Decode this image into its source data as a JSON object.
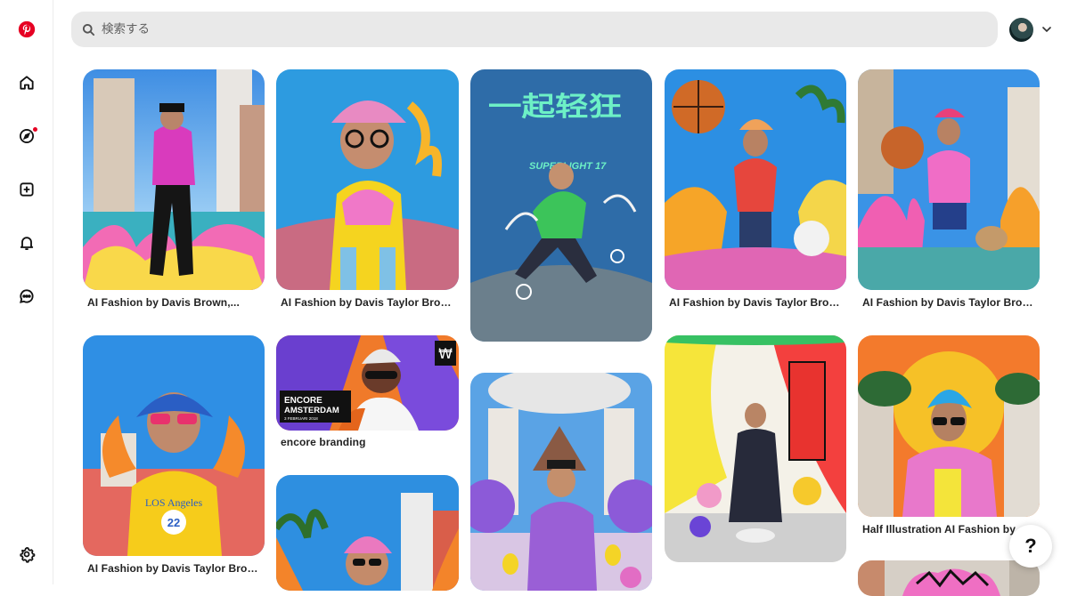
{
  "search": {
    "placeholder": "検索する"
  },
  "pins": [
    {
      "title": "AI Fashion by Davis Brown,..."
    },
    {
      "title": "AI Fashion by Davis Taylor Brow..."
    },
    {
      "title": "AI Fashion by Davis Taylor Brow..."
    },
    {
      "title": "AI Fashion by Davis Taylor Brow..."
    },
    {
      "title": "AI Fashion by Davis Taylor Brow..."
    },
    {
      "title": "encore branding"
    },
    {
      "title": "Half Illustration AI Fashion by..."
    }
  ],
  "poster": {
    "headline": "一起轻狂",
    "subline": "SUPERLIGHT 17"
  },
  "encore": {
    "line1": "ENCORE",
    "line2": "AMSTERDAM",
    "line3": "3 FEBRUARI 2018",
    "badge": "₩"
  },
  "hoodie": {
    "text": "LOS Angeles",
    "number": "22"
  },
  "help": {
    "label": "?"
  },
  "colors": {
    "brand": "#e60023",
    "search_bg": "#e9e9e9"
  },
  "icons": [
    "pinterest-logo-icon",
    "home-icon",
    "explore-compass-icon",
    "create-plus-icon",
    "notifications-bell-icon",
    "messages-icon",
    "settings-gear-icon",
    "search-icon",
    "chevron-down-icon"
  ]
}
